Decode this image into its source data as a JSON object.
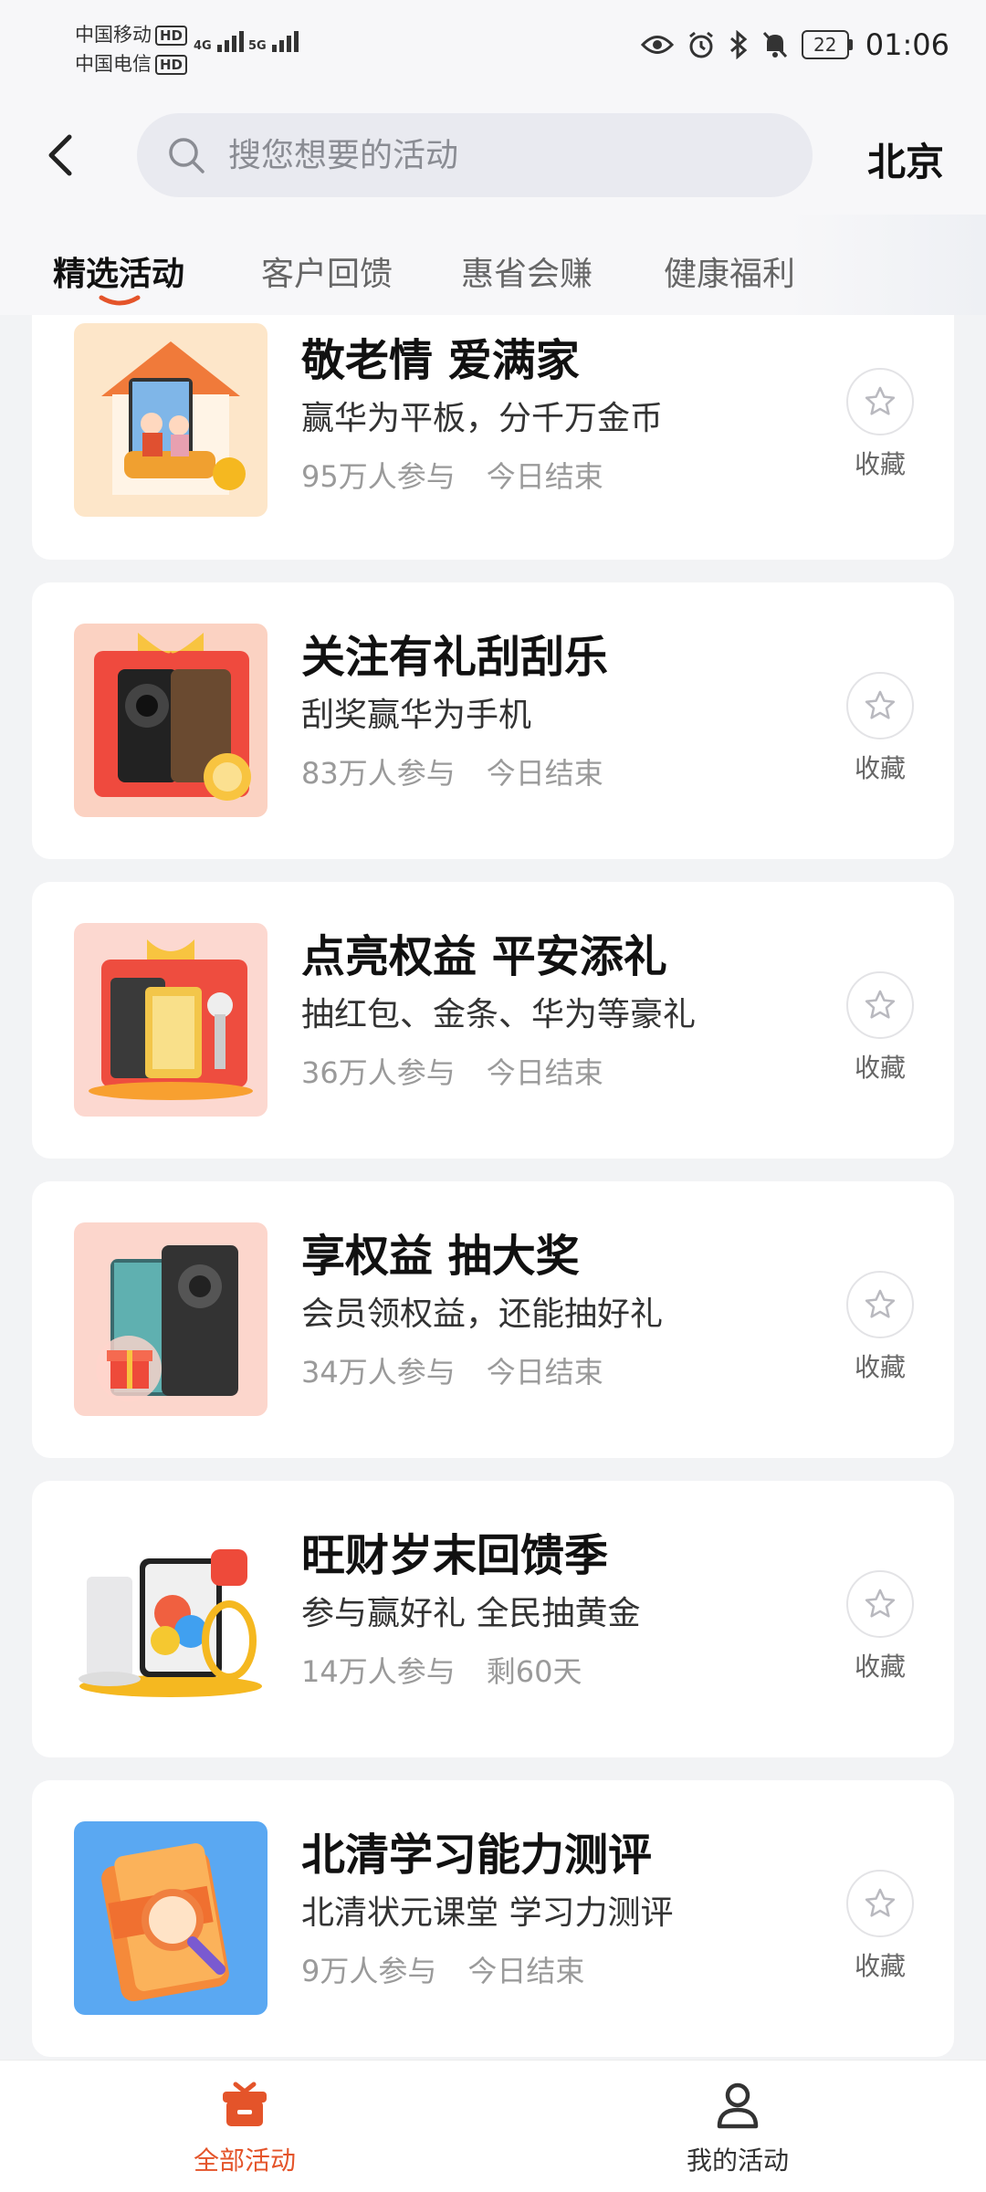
{
  "status_bar": {
    "carrier1": "中国移动",
    "carrier2": "中国电信",
    "hd": "HD",
    "net1": "4G",
    "net2": "5G",
    "battery": "22",
    "time": "01:06"
  },
  "header": {
    "search_placeholder": "搜您想要的活动",
    "city": "北京"
  },
  "tabs": [
    "精选活动",
    "客户回馈",
    "惠省会赚",
    "健康福利"
  ],
  "fav_label": "收藏",
  "activities": [
    {
      "title": "敬老情 爱满家",
      "subtitle": "赢华为平板，分千万金币",
      "participants": "95万人参与",
      "deadline": "今日结束"
    },
    {
      "title": "关注有礼刮刮乐",
      "subtitle": "刮奖赢华为手机",
      "participants": "83万人参与",
      "deadline": "今日结束"
    },
    {
      "title": "点亮权益 平安添礼",
      "subtitle": "抽红包、金条、华为等豪礼",
      "participants": "36万人参与",
      "deadline": "今日结束"
    },
    {
      "title": "享权益 抽大奖",
      "subtitle": "会员领权益，还能抽好礼",
      "participants": "34万人参与",
      "deadline": "今日结束"
    },
    {
      "title": "旺财岁末回馈季",
      "subtitle": "参与赢好礼 全民抽黄金",
      "participants": "14万人参与",
      "deadline": "剩60天"
    },
    {
      "title": "北清学习能力测评",
      "subtitle": "北清状元课堂 学习力测评",
      "participants": "9万人参与",
      "deadline": "今日结束"
    }
  ],
  "bottom_nav": {
    "all": "全部活动",
    "mine": "我的活动"
  },
  "colors": {
    "accent": "#e4542a",
    "card_bg": "#ffffff",
    "page_bg": "#f2f3f5"
  }
}
